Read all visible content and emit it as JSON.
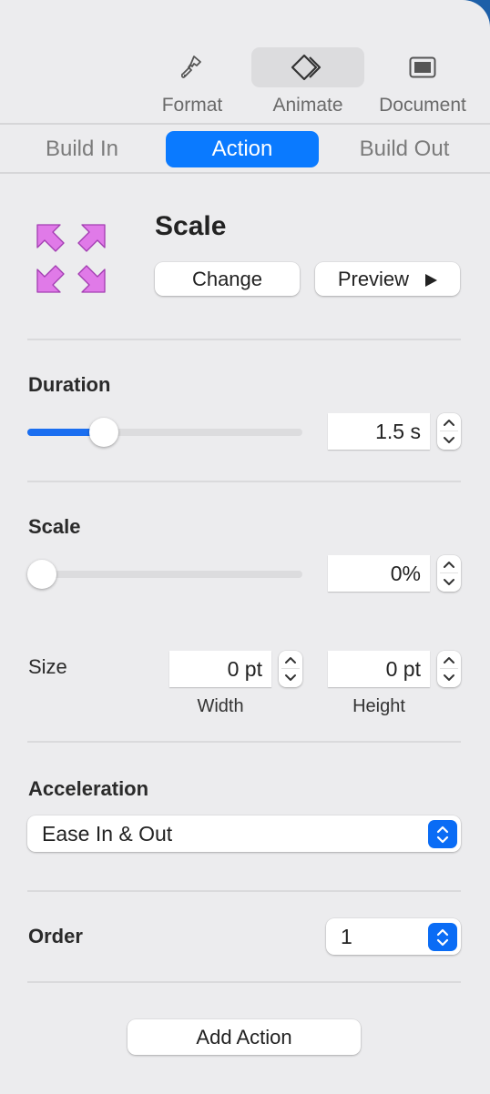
{
  "toolbar": {
    "items": [
      {
        "label": "Format",
        "icon": "paintbrush-icon",
        "active": false
      },
      {
        "label": "Animate",
        "icon": "animate-diamonds-icon",
        "active": true
      },
      {
        "label": "Document",
        "icon": "document-icon",
        "active": false
      }
    ]
  },
  "tabs": [
    {
      "label": "Build In",
      "active": false
    },
    {
      "label": "Action",
      "active": true
    },
    {
      "label": "Build Out",
      "active": false
    }
  ],
  "effect": {
    "name": "Scale",
    "icon": "scale-arrows-icon",
    "icon_color": "#e07ae8",
    "change_label": "Change",
    "preview_label": "Preview",
    "preview_icon": "play-icon"
  },
  "duration": {
    "label": "Duration",
    "value": "1.5 s",
    "slider_fraction": 0.25
  },
  "scale": {
    "label": "Scale",
    "value": "0%",
    "slider_fraction": 0.0
  },
  "size": {
    "label": "Size",
    "width_value": "0 pt",
    "width_label": "Width",
    "height_value": "0 pt",
    "height_label": "Height"
  },
  "acceleration": {
    "label": "Acceleration",
    "selected": "Ease In & Out"
  },
  "order": {
    "label": "Order",
    "selected": "1"
  },
  "add_action_label": "Add Action",
  "colors": {
    "accent": "#0a7aff",
    "slider_fill": "#1a6ef0"
  }
}
